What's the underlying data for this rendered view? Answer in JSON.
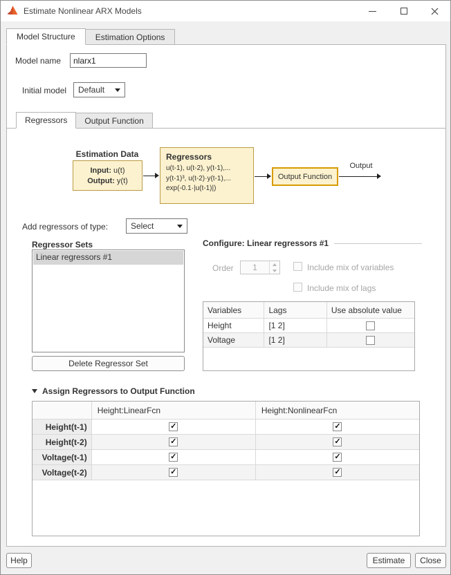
{
  "window": {
    "title": "Estimate Nonlinear ARX Models",
    "icons": [
      "matlab-icon",
      "minimize-icon",
      "maximize-icon",
      "close-icon"
    ]
  },
  "tabs": {
    "model_structure": "Model Structure",
    "estimation_options": "Estimation Options"
  },
  "fields": {
    "model_name_label": "Model name",
    "model_name_value": "nlarx1",
    "initial_model_label": "Initial model",
    "initial_model_value": "Default"
  },
  "subtabs": {
    "regressors": "Regressors",
    "output_function": "Output Function"
  },
  "diagram": {
    "estimation_data": {
      "title": "Estimation Data",
      "input_label": "Input:",
      "input_value": "u(t)",
      "output_label": "Output:",
      "output_value": "y(t)"
    },
    "regressors_box": {
      "title": "Regressors",
      "lines": [
        "u(t-1), u(t-2), y(t-1),...",
        "y(t-1)³, u(t-2)·y(t-1),...",
        "exp(-0.1·|u(t-1)|)"
      ]
    },
    "output_function_box": "Output Function",
    "output_arrow_label": "Output"
  },
  "add_regressors": {
    "label": "Add regressors of type:",
    "value": "Select"
  },
  "regressor_sets": {
    "title": "Regressor Sets",
    "items": [
      {
        "label": "Linear regressors #1",
        "selected": true
      }
    ],
    "delete_button": "Delete Regressor Set"
  },
  "configure": {
    "title": "Configure: Linear regressors #1",
    "order_label": "Order",
    "order_value": "1",
    "mix_variables_label": "Include mix of variables",
    "mix_variables_checked": false,
    "mix_lags_label": "Include mix of lags",
    "mix_lags_checked": false,
    "table": {
      "headers": [
        "Variables",
        "Lags",
        "Use absolute value"
      ],
      "rows": [
        {
          "variable": "Height",
          "lags": "[1 2]",
          "use_abs": false
        },
        {
          "variable": "Voltage",
          "lags": "[1 2]",
          "use_abs": false
        }
      ]
    }
  },
  "assign": {
    "title": "Assign Regressors to Output Function",
    "columns": [
      "Height:LinearFcn",
      "Height:NonlinearFcn"
    ],
    "rows": [
      {
        "label": "Height(t-1)",
        "linear": true,
        "nonlinear": true
      },
      {
        "label": "Height(t-2)",
        "linear": true,
        "nonlinear": true
      },
      {
        "label": "Voltage(t-1)",
        "linear": true,
        "nonlinear": true
      },
      {
        "label": "Voltage(t-2)",
        "linear": true,
        "nonlinear": true
      }
    ]
  },
  "footer": {
    "help": "Help",
    "estimate": "Estimate",
    "close": "Close"
  }
}
